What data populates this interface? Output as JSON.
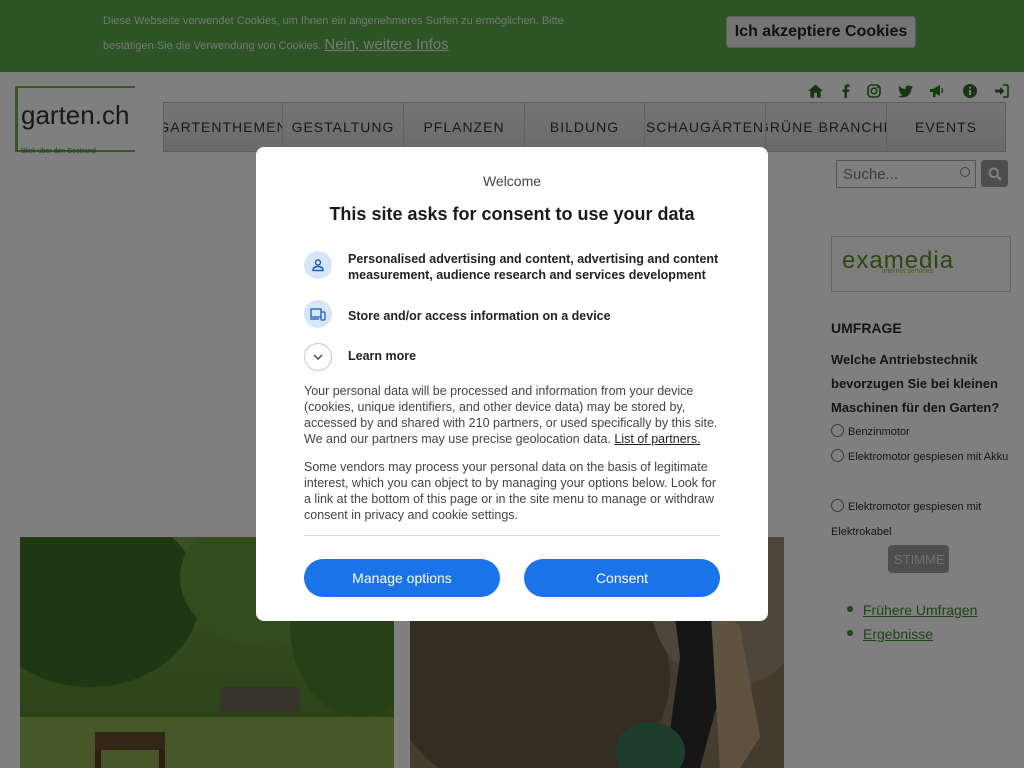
{
  "cookie_bar": {
    "text": "Diese Webseite verwendet Cookies, um Ihnen ein angenehmeres Surfen zu ermöglichen. Bitte bestätigen Sie die Verwendung von Cookies.",
    "more_link": "Nein, weitere Infos",
    "accept_label": "Ich akzeptiere Cookies"
  },
  "logo": {
    "name": "garten.ch",
    "tagline": "Blick über den Beetrand"
  },
  "top_icons": [
    "home-icon",
    "facebook-icon",
    "instagram-icon",
    "twitter-icon",
    "megaphone-icon",
    "info-icon",
    "login-icon"
  ],
  "nav": {
    "items": [
      "GARTENTHEMEN",
      "GESTALTUNG",
      "PFLANZEN",
      "BILDUNG",
      "SCHAUGÄRTEN",
      "GRÜNE BRANCHE",
      "EVENTS"
    ]
  },
  "search": {
    "placeholder": "Suche..."
  },
  "sidebar": {
    "ad": {
      "brand": "examedia",
      "sub": "internet services"
    },
    "poll": {
      "title": "UMFRAGE",
      "question": "Welche Antriebstechnik bevorzugen Sie bei kleinen Maschinen für den Garten?",
      "options": [
        "Benzinmotor",
        "Elektromotor gespiesen mit Akku",
        "Elektromotor gespiesen mit Elektrokabel"
      ],
      "vote_label": "STIMME"
    },
    "links": [
      "Frühere Umfragen",
      "Ergebnisse"
    ]
  },
  "consent": {
    "welcome": "Welcome",
    "title": "This site asks for consent to use your data",
    "purposes": [
      "Personalised advertising and content, advertising and content measurement, audience research and services development",
      "Store and/or access information on a device"
    ],
    "learn_more": "Learn more",
    "para1": "Your personal data will be processed and information from your device (cookies, unique identifiers, and other device data) may be stored by, accessed by and shared with 210 partners, or used specifically by this site. We and our partners may use precise geolocation data.",
    "partners_link": "List of partners.",
    "para2": "Some vendors may process your personal data on the basis of legitimate interest, which you can object to by managing your options below. Look for a link at the bottom of this page or in the site menu to manage or withdraw consent in privacy and cookie settings.",
    "manage_label": "Manage options",
    "consent_label": "Consent",
    "button_color": "#1a73e8"
  }
}
